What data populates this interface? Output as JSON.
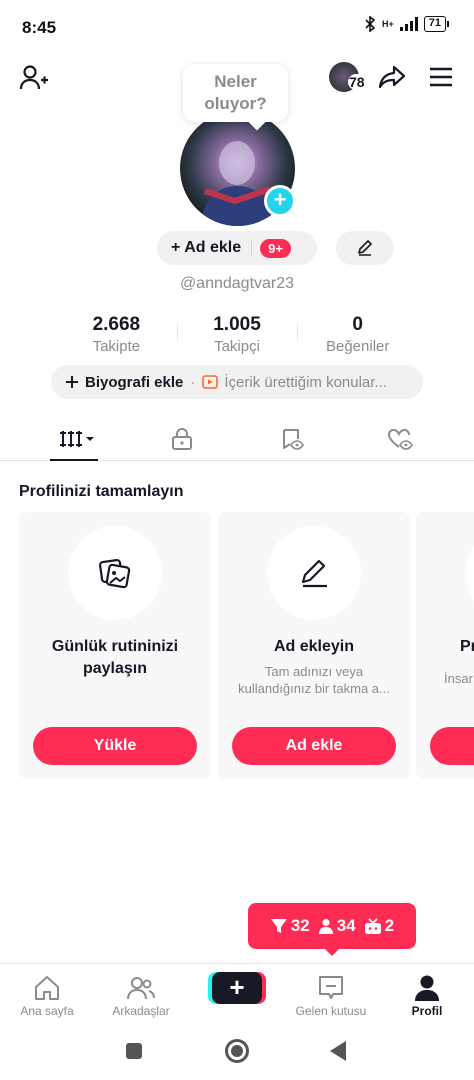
{
  "status": {
    "time": "8:45",
    "network": "H+",
    "battery": "71"
  },
  "header": {
    "bubble_line1": "Neler",
    "bubble_line2": "oluyor?",
    "story_count": "78",
    "add_name_label": "+ Ad ekle",
    "add_name_badge": "9+",
    "username": "@anndagtvar23"
  },
  "stats": [
    {
      "value": "2.668",
      "label": "Takipte"
    },
    {
      "value": "1.005",
      "label": "Takipçi"
    },
    {
      "value": "0",
      "label": "Beğeniler"
    }
  ],
  "bio": {
    "add_label": "Biyografi ekle",
    "hint": "İçerik ürettiğim konular..."
  },
  "section": {
    "title": "Profilinizi tamamlayın"
  },
  "cards": [
    {
      "title": "Günlük rutininizi paylaşın",
      "description": "",
      "button": "Yükle",
      "icon": "photos-icon"
    },
    {
      "title": "Ad ekleyin",
      "description": "Tam adınızı veya kullandığınız bir takma a...",
      "button": "Ad ekle",
      "icon": "pencil-icon"
    },
    {
      "title": "Pr",
      "description": "İnsar",
      "button": "",
      "icon": ""
    }
  ],
  "notifications": {
    "filter": "32",
    "followers": "34",
    "live": "2"
  },
  "bottom_nav": [
    {
      "label": "Ana sayfa",
      "icon": "home-icon"
    },
    {
      "label": "Arkadaşlar",
      "icon": "friends-icon"
    },
    {
      "label": "",
      "icon": "create-icon"
    },
    {
      "label": "Gelen kutusu",
      "icon": "inbox-icon"
    },
    {
      "label": "Profil",
      "icon": "profile-icon"
    }
  ],
  "colors": {
    "accent": "#fe2c55",
    "cyan": "#25f4ee",
    "text": "#161823",
    "muted": "#8a8b91"
  }
}
